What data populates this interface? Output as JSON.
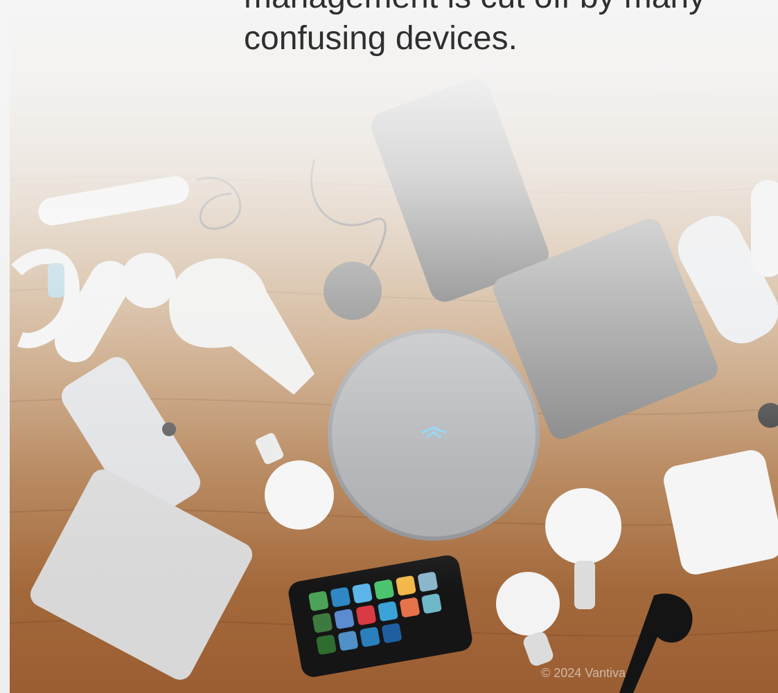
{
  "headline": {
    "line1": "management is cut off by many",
    "line2": "confusing devices."
  },
  "photo": {
    "subject": "smart-home-devices-on-wooden-table"
  },
  "copyright": "© 2024 Vantiva",
  "colors": {
    "background": "#f3f3f3",
    "wood": "#b9854f",
    "headline_text": "#2f2f2f"
  }
}
